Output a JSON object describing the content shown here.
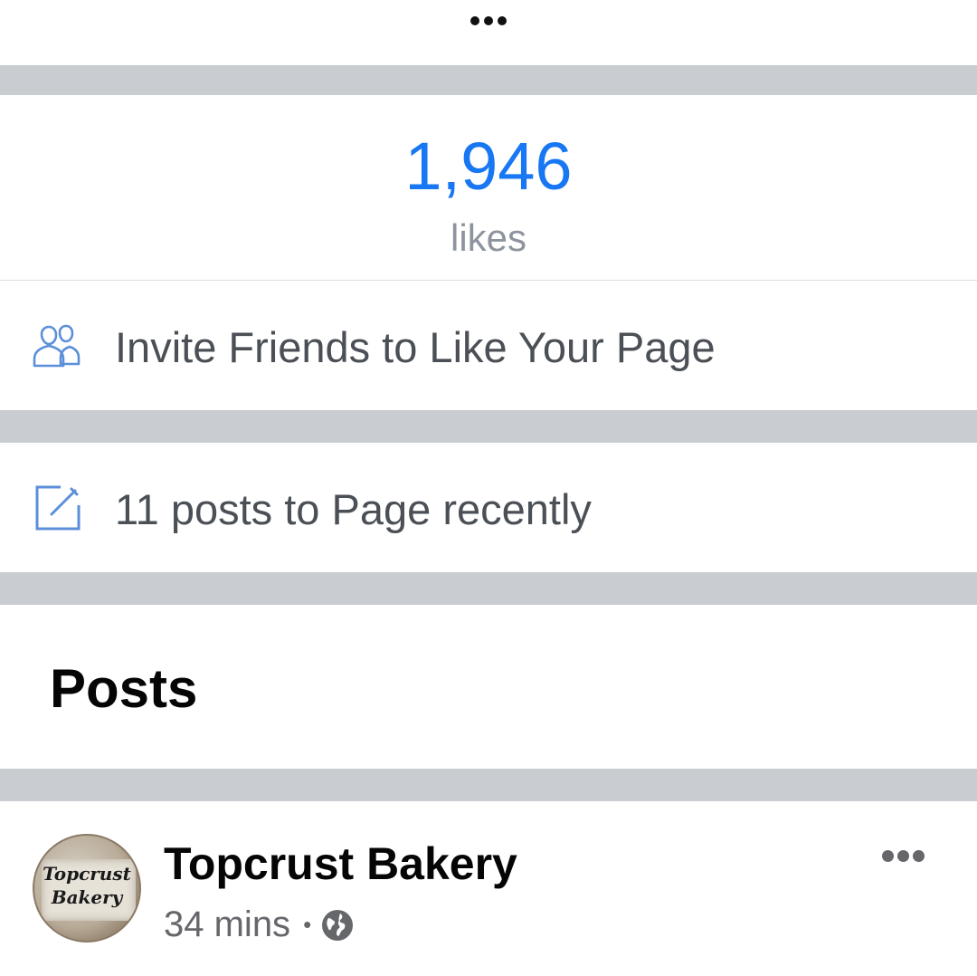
{
  "top_bar": {
    "more_icon": "ellipsis-horizontal-icon"
  },
  "likes": {
    "count": "1,946",
    "label": "likes"
  },
  "invite": {
    "icon": "friends-icon",
    "label": "Invite Friends to Like Your Page"
  },
  "recent_posts": {
    "icon": "compose-icon",
    "label": "11 posts to Page recently"
  },
  "posts_section": {
    "heading": "Posts"
  },
  "post": {
    "page_name": "Topcrust Bakery",
    "avatar_text_line1": "Topcrust",
    "avatar_text_line2": "Bakery",
    "time": "34 mins",
    "separator": "•",
    "audience_icon": "globe-icon",
    "more_icon": "ellipsis-horizontal-icon"
  },
  "colors": {
    "accent": "#1877f2",
    "divider": "#c9ccd1",
    "secondary_text": "#8d949e",
    "body_text": "#4b4f56",
    "icon_blue": "#5b8fd9"
  }
}
